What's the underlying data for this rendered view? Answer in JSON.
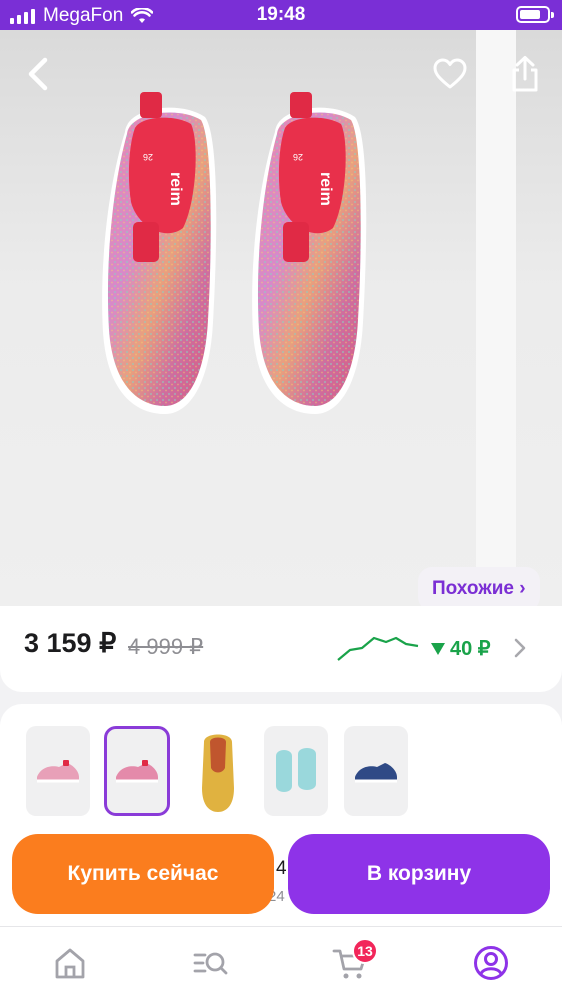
{
  "status_bar": {
    "carrier": "MegaFon",
    "time": "19:48"
  },
  "product": {
    "similar_label": "Похожие ›",
    "price": "3 159 ₽",
    "old_price": "4 999 ₽",
    "price_drop": "40 ₽",
    "brand_print": "reim",
    "size_print": "26"
  },
  "variants": {
    "selected_index": 1,
    "items": [
      {
        "color": "pink-low"
      },
      {
        "color": "pink"
      },
      {
        "color": "yellow"
      },
      {
        "color": "mint"
      },
      {
        "color": "navy"
      }
    ],
    "peek_text": "4",
    "peek_subtext": "24"
  },
  "actions": {
    "buy_now": "Купить сейчас",
    "add_to_cart": "В корзину"
  },
  "tabbar": {
    "items": [
      {
        "icon": "home-icon"
      },
      {
        "icon": "catalog-search-icon"
      },
      {
        "icon": "cart-icon"
      },
      {
        "icon": "profile-icon"
      }
    ],
    "cart_count": "13"
  },
  "colors": {
    "accent": "#8e33e8",
    "buy_button": "#fb7d1e",
    "status_bar": "#7a2fd6",
    "price_drop": "#1aa34a",
    "badge": "#f2265a"
  }
}
